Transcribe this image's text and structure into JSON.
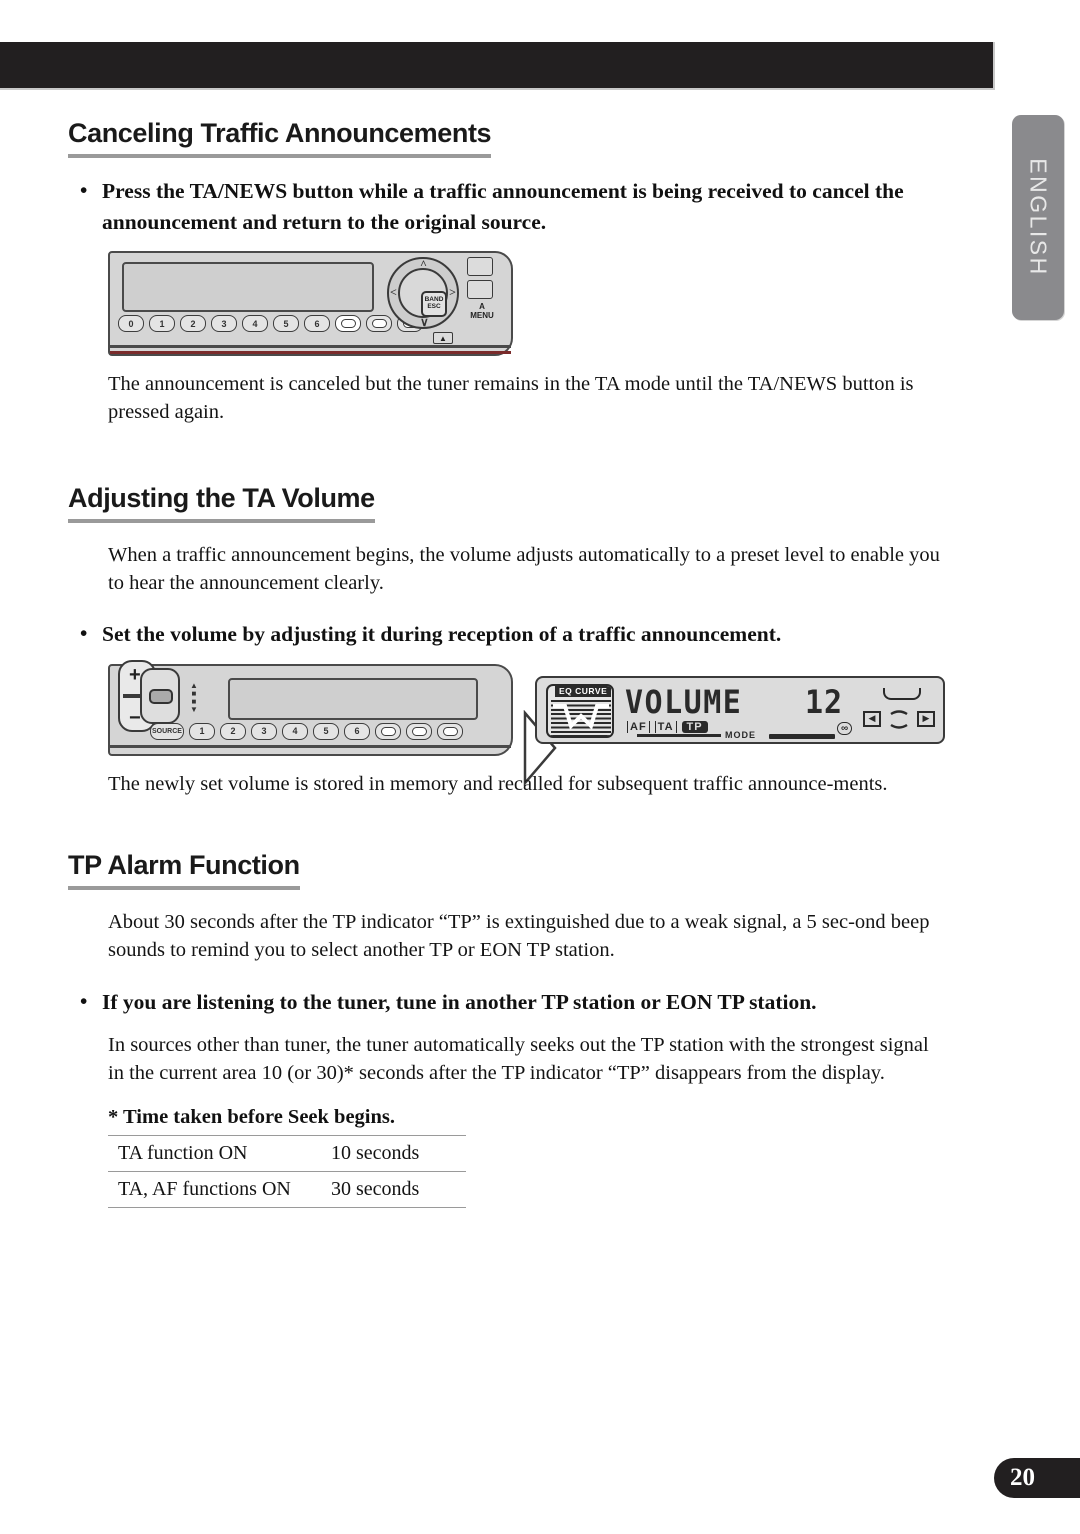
{
  "page": {
    "number": "20",
    "language_tab": "ENGLISH"
  },
  "sections": [
    {
      "heading": "Canceling Traffic Announcements",
      "bullet": "Press the TA/NEWS button while a traffic announcement is being received to cancel the announcement and return to the original source.",
      "paragraph": "The announcement is canceled but the tuner remains in the TA mode until the TA/NEWS button is pressed again."
    },
    {
      "heading": "Adjusting the TA Volume",
      "paragraph_before": "When a traffic announcement begins, the volume adjusts automatically to a preset level to enable you to hear the announcement clearly.",
      "bullet": "Set the volume by adjusting it during reception of a traffic announcement.",
      "paragraph_after": "The newly set volume is stored in memory and recalled for subsequent traffic announce-ments."
    },
    {
      "heading": "TP Alarm Function",
      "paragraph_before": "About 30 seconds after the TP indicator “TP” is extinguished due to a weak signal, a 5 sec-ond beep sounds to remind you to select another TP or EON TP station.",
      "bullet": "If you are listening to the tuner, tune in another TP station or EON TP station.",
      "paragraph_after": "In sources other than tuner, the tuner automatically seeks out the TP station with the strongest signal in the current area 10 (or 30)* seconds after the TP indicator “TP” disappears from the display."
    }
  ],
  "seek_table": {
    "title": "* Time taken before Seek begins.",
    "rows": [
      {
        "condition": "TA function ON",
        "time": "10 seconds"
      },
      {
        "condition": "TA, AF functions ON",
        "time": "30 seconds"
      }
    ]
  },
  "faceplate1": {
    "preset_buttons": [
      "0",
      "1",
      "2",
      "3",
      "4",
      "5",
      "6"
    ],
    "joystick_label": "BAND\nESC",
    "side_label_a": "A",
    "side_label_menu": "MENU",
    "eject_icon": "eject-icon"
  },
  "faceplate2": {
    "volume_plus": "+",
    "volume_minus": "−",
    "source_button": "SOURCE",
    "preset_buttons": [
      "1",
      "2",
      "3",
      "4",
      "5",
      "6"
    ],
    "updown_marks": "▲▼"
  },
  "lcd_display": {
    "eq_curve_label": "EQ CURVE",
    "main_text": "VOLUME",
    "value": "12",
    "indicators": [
      "AF",
      "TA",
      "TP"
    ],
    "active_indicator": "TP",
    "mode_label": "MODE",
    "stereo_label": "∞",
    "nav_left": "◀",
    "nav_right": "▶"
  },
  "colors": {
    "band": "#221f20",
    "heading_rule": "#9a9a9a",
    "lang_tab": "#8a8a8d",
    "faceplate": "#d5d5d5",
    "lcd_bg": "#dcdcdc"
  }
}
